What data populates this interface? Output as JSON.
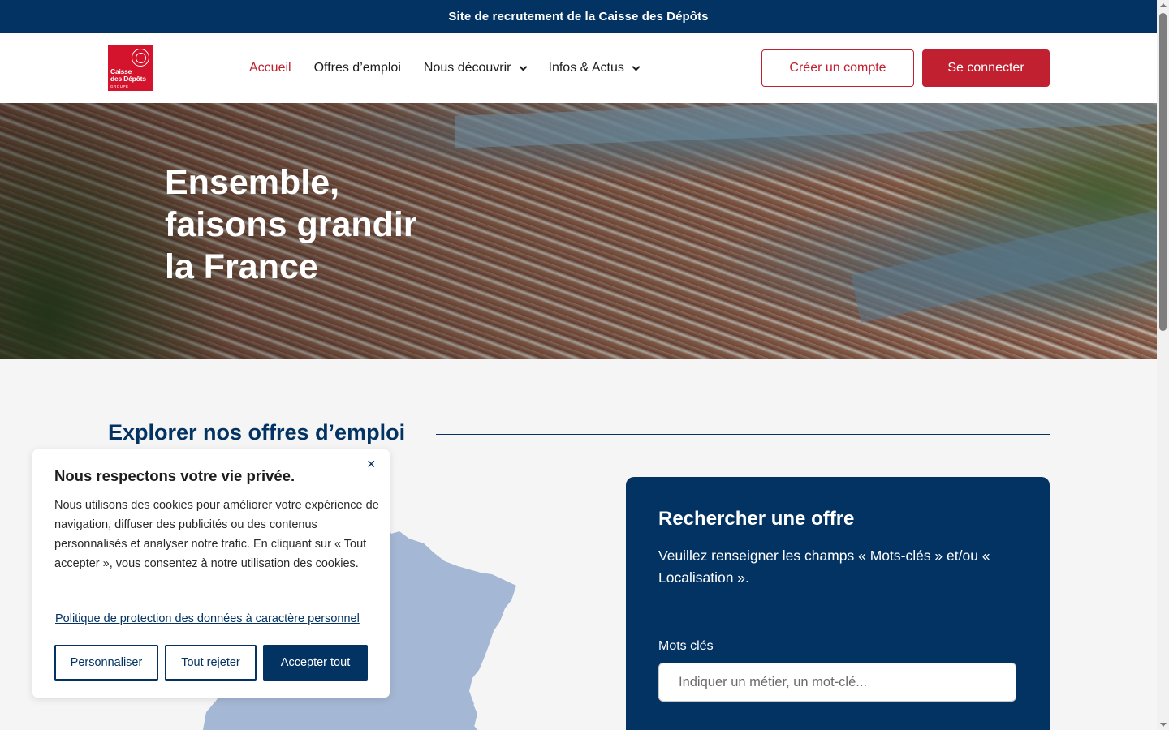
{
  "topbar": {
    "text": "Site de recrutement de la Caisse des Dépôts"
  },
  "logo": {
    "line1": "Caisse",
    "line2": "des Dépôts",
    "group": "GROUPE"
  },
  "nav": {
    "items": [
      {
        "label": "Accueil"
      },
      {
        "label": "Offres d’emploi"
      },
      {
        "label": "Nous découvrir"
      },
      {
        "label": "Infos & Actus"
      }
    ]
  },
  "header": {
    "create_account": "Créer un compte",
    "login": "Se connecter"
  },
  "hero": {
    "line1": "Ensemble,",
    "line2": "faisons grandir",
    "line3": "la France"
  },
  "explore": {
    "title": "Explorer nos offres d’emploi"
  },
  "search": {
    "title": "Rechercher une offre",
    "description": "Veuillez renseigner les champs « Mots-clés » et/ou « Localisation ».",
    "keywords_label": "Mots clés",
    "keywords_placeholder": "Indiquer un métier, un mot-clé..."
  },
  "cookie": {
    "close": "×",
    "title": "Nous respectons votre vie privée.",
    "text": "Nous utilisons des cookies pour améliorer votre expérience de navigation, diffuser des publicités ou des contenus personnalisés et analyser notre trafic. En cliquant sur « Tout accepter », vous consentez à notre utilisation des cookies.",
    "policy_link": "Politique de protection des données à caractère personnel",
    "customize": "Personnaliser",
    "reject": "Tout rejeter",
    "accept": "Accepter tout"
  },
  "colors": {
    "navy": "#033363",
    "red": "#c0202f",
    "map": "#a4b7d4"
  }
}
